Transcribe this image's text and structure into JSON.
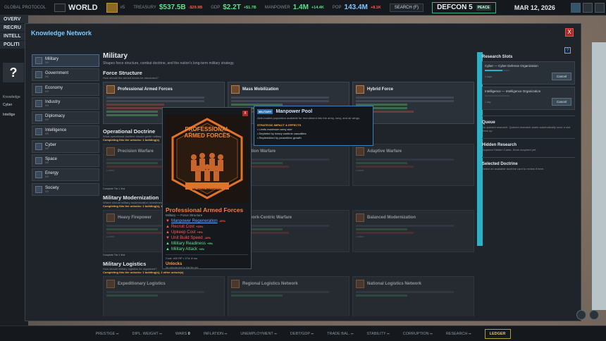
{
  "topbar": {
    "brand": "GLOBAL PROTOCOL",
    "world": "WORLD",
    "emblem_count": "#5",
    "treasury_label": "TREASURY",
    "treasury_value": "$537.5B",
    "treasury_delta": "-$29.9B",
    "gdp_label": "GDP",
    "gdp_value": "$2.2T",
    "gdp_delta": "+$1.7B",
    "manpower_label": "MANPOWER",
    "manpower_value": "1.4M",
    "manpower_delta": "+14.4K",
    "pop_label": "POP",
    "pop_value": "143.4M",
    "pop_delta": "+8.1K",
    "search_label": "SEARCH (F)",
    "defcon_label": "DEFCON 5",
    "defcon_state": "PEACE",
    "date": "MAR 12, 2026"
  },
  "leftbar": {
    "tabs": [
      "OVERV",
      "RECRU",
      "INTELL",
      "POLITI"
    ],
    "question": "?",
    "knowledge": "Knowledge",
    "items": [
      "Cyber",
      "Intellige"
    ]
  },
  "modal": {
    "title": "Knowledge Network",
    "close": "X",
    "help": "?",
    "categories": [
      {
        "name": "Military",
        "sub": "3/9"
      },
      {
        "name": "Government",
        "sub": "0/9"
      },
      {
        "name": "Economy",
        "sub": "0/9"
      },
      {
        "name": "Industry",
        "sub": "0/9"
      },
      {
        "name": "Diplomacy",
        "sub": "0/9"
      },
      {
        "name": "Intelligence",
        "sub": "0/9"
      },
      {
        "name": "Cyber",
        "sub": "0/9"
      },
      {
        "name": "Space",
        "sub": "0/9"
      },
      {
        "name": "Energy",
        "sub": "0/9"
      },
      {
        "name": "Society",
        "sub": "0/9"
      }
    ],
    "heading": "Military",
    "heading_desc": "Shapes force structure, combat doctrine, and the nation's long-term military strategy.",
    "sections": [
      {
        "title": "Force Structure",
        "question": "How should the armed forces be structured?",
        "note": "",
        "cards": [
          "Professional Armed Forces",
          "Mass Mobilization",
          "Hybrid Force"
        ],
        "tier": ""
      },
      {
        "title": "Operational Doctrine",
        "question": "What operational doctrine should guide military planning?",
        "note": "Completing this tier unlocks: 1 building(s)",
        "cards": [
          "Precision Warfare",
          "Attrition Warfare",
          "Adaptive Warfare"
        ],
        "tier": "Complete Tier 1 first"
      },
      {
        "title": "Military Modernization",
        "question": "Where should military modernization investment be focused?",
        "note": "Completing this tier unlocks: 1 building(s), 1 other unlock(s)",
        "cards": [
          "Heavy Firepower",
          "Network-Centric Warfare",
          "Balanced Modernization"
        ],
        "tier": "Complete Tier 1 first"
      },
      {
        "title": "Military Logistics",
        "question": "How should military logistics be organized?",
        "note": "Completing this tier unlocks: 1 building(s), 1 other unlock(s)",
        "cards": [
          "Expeditionary Logistics",
          "Regional Logistics Network",
          "National Logistics Network"
        ],
        "tier": ""
      }
    ],
    "locked": "Locked",
    "side": {
      "slots_title": "Research Slots",
      "slots": [
        {
          "name": "Cyber — Cyber Defense Organization",
          "days": "4 days",
          "progress": 0.7,
          "cancel": "Cancel"
        },
        {
          "name": "Intelligence — Intelligence Organization",
          "days": "1 day",
          "progress": 0.0,
          "cancel": "Cancel"
        }
      ],
      "queue_title": "Queue",
      "queue_text": "No queued research. Queued research starts automatically once a slot frees up.",
      "hidden_title": "Hidden Research",
      "hidden_text": "Acquired Hidden Cards. None acquired yet.",
      "doctrine_title": "Selected Doctrine",
      "doctrine_text": "Select an available doctrine card to review it here."
    }
  },
  "popup": {
    "close": "X",
    "poster_line1": "PROFESSIONAL",
    "poster_line2": "ARMED FORCES",
    "poster_footer": "MILITARY PROTOCOL",
    "title": "Professional Armed Forces",
    "subtitle": "Military — Force Structure",
    "stats": [
      {
        "label": "Manpower Regeneration",
        "value": "-20%",
        "color": "#ff5a4e",
        "icon": "▼"
      },
      {
        "label": "Recruit Cost",
        "value": "+15%",
        "color": "#ff5a4e",
        "icon": "▲"
      },
      {
        "label": "Upkeep Cost",
        "value": "+5%",
        "color": "#ff5a4e",
        "icon": "▲"
      },
      {
        "label": "Unit Build Speed",
        "value": "-10%",
        "color": "#ff5a4e",
        "icon": "▼"
      },
      {
        "label": "Military Readiness",
        "value": "+5%",
        "color": "#5ee08a",
        "icon": "▲"
      },
      {
        "label": "Military Attack",
        "value": "+4%",
        "color": "#5ee08a",
        "icon": "▲"
      }
    ],
    "cost": "Cost: 400 RP • 27d: 8 mo",
    "unlocks_title": "Unlocks",
    "unlocks_text": "No unlocks tied to this tier yet."
  },
  "tooltip": {
    "tag": "MILITARY",
    "title": "Manpower Pool",
    "desc": "Able-bodied population available for recruitment into the army, navy, and air wings.",
    "header": "STRATEGIC IMPACT & EFFECTS",
    "items": [
      "• Limits maximum army size",
      "• Depleted by heavy wartime casualties",
      "• Replenished by peacetime growth"
    ]
  },
  "bottombar": [
    {
      "label": "PRESTIGE",
      "value": "--"
    },
    {
      "label": "DIPL. WEIGHT",
      "value": "--"
    },
    {
      "label": "WARS",
      "value": "0"
    },
    {
      "label": "INFLATION",
      "value": "--"
    },
    {
      "label": "UNEMPLOYMENT",
      "value": "--"
    },
    {
      "label": "DEBT/GDP",
      "value": "--"
    },
    {
      "label": "TRADE BAL.",
      "value": "--"
    },
    {
      "label": "STABILITY",
      "value": "--"
    },
    {
      "label": "CORRUPTION",
      "value": "--"
    },
    {
      "label": "RESEARCH",
      "value": "--"
    }
  ],
  "ledger": "LEDGER"
}
